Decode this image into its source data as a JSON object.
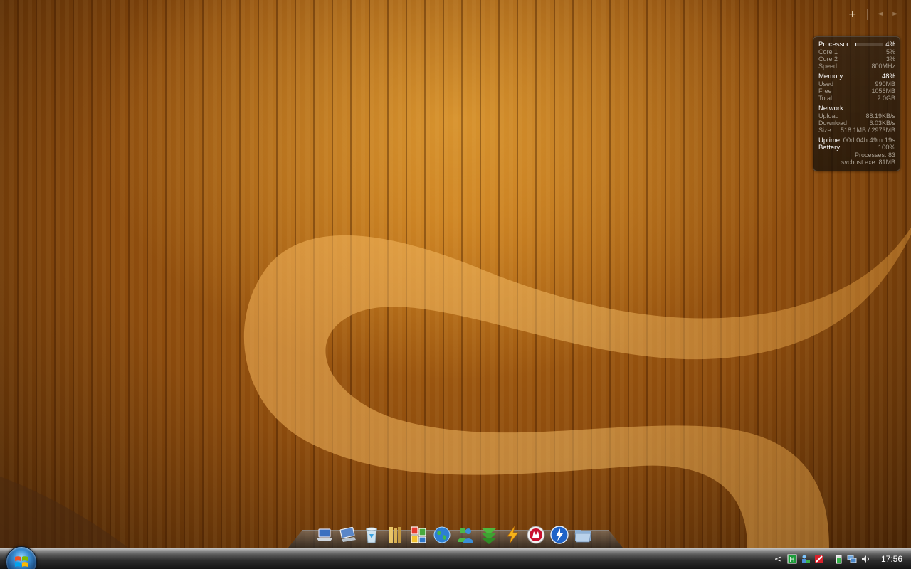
{
  "desktop": {
    "sidebar_controls": {
      "add_symbol": "+",
      "prev_symbol": "◄",
      "next_symbol": "►"
    },
    "system_meter": {
      "processor": {
        "label": "Processor",
        "percent": "4%",
        "load_fraction": 0.04,
        "rows": [
          {
            "label": "Core 1",
            "value": "5%"
          },
          {
            "label": "Core 2",
            "value": "3%"
          },
          {
            "label": "Speed",
            "value": "800MHz"
          }
        ]
      },
      "memory": {
        "label": "Memory",
        "percent": "48%",
        "rows": [
          {
            "label": "Used",
            "value": "990MB"
          },
          {
            "label": "Free",
            "value": "1056MB"
          },
          {
            "label": "Total",
            "value": "2.0GB"
          }
        ]
      },
      "network": {
        "label": "Network",
        "rows": [
          {
            "label": "Upload",
            "value": "88.19KB/s"
          },
          {
            "label": "Download",
            "value": "6.03KB/s"
          },
          {
            "label": "Size",
            "value": "518.1MB / 2973MB"
          }
        ]
      },
      "uptime": {
        "label": "Uptime",
        "value": "00d 04h 49m 19s"
      },
      "battery": {
        "label": "Battery",
        "value": "100%"
      },
      "processes": "Processes: 83",
      "top_process": "svchost.exe: 81MB"
    }
  },
  "dock": {
    "items": [
      {
        "icon": "laptop-icon"
      },
      {
        "icon": "network-computer-icon"
      },
      {
        "icon": "recycle-bin-icon"
      },
      {
        "icon": "library-icon"
      },
      {
        "icon": "office-icon"
      },
      {
        "icon": "globe-icon"
      },
      {
        "icon": "messenger-icon"
      },
      {
        "icon": "download-arrow-icon"
      },
      {
        "icon": "lightning-icon"
      },
      {
        "icon": "mcafee-icon"
      },
      {
        "icon": "daemon-tools-icon"
      },
      {
        "icon": "folder-icon"
      }
    ]
  },
  "taskbar": {
    "clock": "17:56",
    "tray_expand": "<",
    "tray_icons": [
      "h-app-icon",
      "network-users-icon",
      "antivirus-icon",
      "battery-icon",
      "network-icon",
      "volume-icon"
    ]
  },
  "colors": {
    "wood_accent": "#b86a14",
    "taskbar_dark": "#141414"
  }
}
